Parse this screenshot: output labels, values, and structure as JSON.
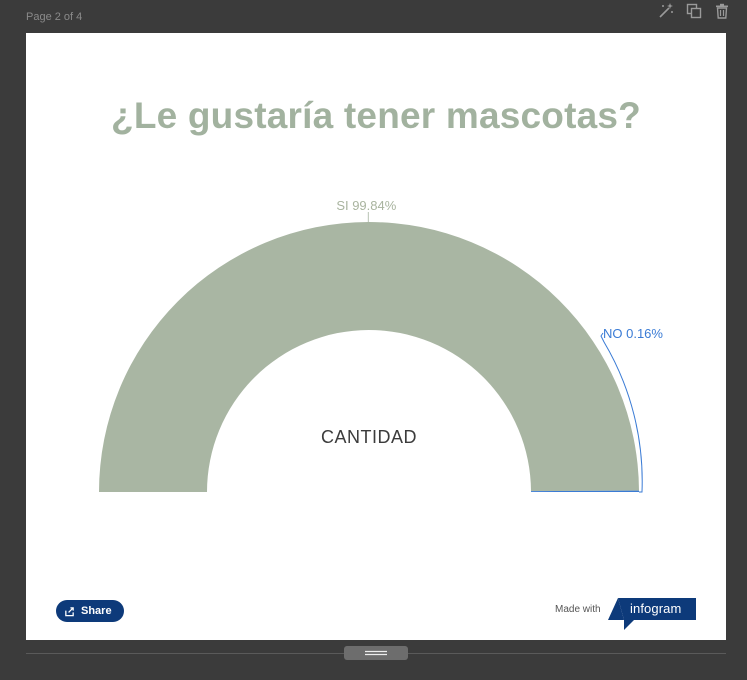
{
  "page": {
    "label": "Page 2 of 4"
  },
  "toolbar": {
    "icons": [
      "magic-wand-icon",
      "duplicate-icon",
      "trash-icon"
    ]
  },
  "colors": {
    "accent": "#a9b6a3",
    "title": "#a2b29f",
    "no_series": "#3a7bd5",
    "share_bg": "#0d3a7a",
    "brand_bg": "#0d3a7a"
  },
  "chart_data": {
    "type": "pie",
    "variant": "semi-donut",
    "title": "¿Le gustaría tener mascotas?",
    "center_label": "CANTIDAD",
    "slices": [
      {
        "label": "SI",
        "value": 99.84,
        "display": "SI 99.84%",
        "color": "#a9b6a3"
      },
      {
        "label": "NO",
        "value": 0.16,
        "display": "NO 0.16%",
        "color": "#3a7bd5"
      }
    ]
  },
  "footer": {
    "share_label": "Share",
    "made_with": "Made with",
    "brand": "infogram"
  }
}
